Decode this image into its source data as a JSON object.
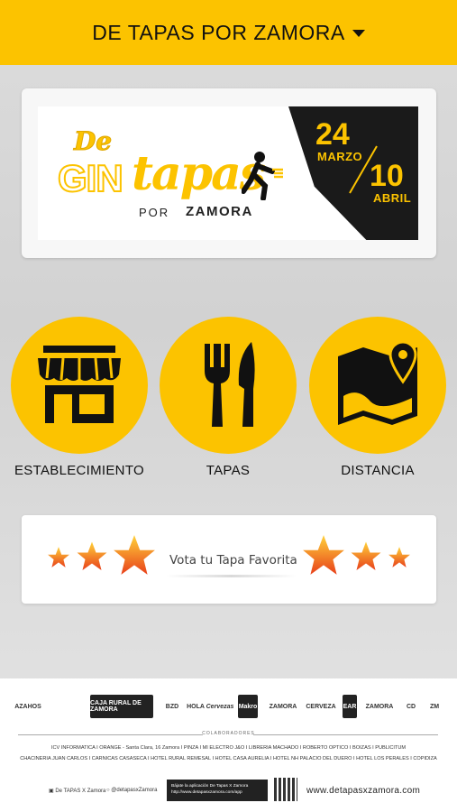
{
  "header": {
    "title": "DE TAPAS POR ZAMORA"
  },
  "banner": {
    "logo_de": "De",
    "logo_gin": "GIN",
    "logo_tapas": "tapas",
    "logo_por": "POR",
    "logo_zamora": "ZAMORA",
    "start_day": "24",
    "start_month": "MARZO",
    "end_day": "10",
    "end_month": "ABRIL"
  },
  "categories": [
    {
      "label": "ESTABLECIMIENTO",
      "icon": "store-icon"
    },
    {
      "label": "TAPAS",
      "icon": "fork-knife-icon"
    },
    {
      "label": "DISTANCIA",
      "icon": "map-pin-icon"
    }
  ],
  "vote": {
    "label": "Vota tu Tapa Favorita"
  },
  "footer": {
    "sponsors": [
      "AZAHOS",
      "CAJA RURAL DE ZAMORA",
      "BZD",
      "HOLA",
      "Cervezas",
      "Makro",
      "ZAMORA",
      "CERVEZA",
      "EAR",
      "ZAMORA",
      "CD",
      "ZM"
    ],
    "collaborators_title": "COLABORADORES",
    "collaborators_line1": "ICV INFORMATICA  I  ORANGE - Santa Clara, 16 Zamora  I  PINZA  I  MI ELECTRO J&O  I  LIBRERIA MACHADO  I  ROBERTO OPTICO  I  BOIZAS  I  PUBLICITUM",
    "collaborators_line2": "CHACINERIA JUAN CARLOS  I  CARNICAS CASASECA  I  HOTEL RURAL REMESAL  I  HOTEL CASA AURELIA  I  HOTEL NH PALACIO DEL DUERO  I  HOTEL LOS PERALES  I  COPIDIZA",
    "facebook": "De TAPAS X Zamora",
    "twitter": "@detapasxZamora",
    "app_text_1": "Bájate la aplicación De Tapas X Zamora",
    "app_text_2": "http://www.detapasxzamora.com/app",
    "website": "www.detapasxzamora.com"
  },
  "colors": {
    "accent": "#fcc300",
    "text": "#111111"
  }
}
